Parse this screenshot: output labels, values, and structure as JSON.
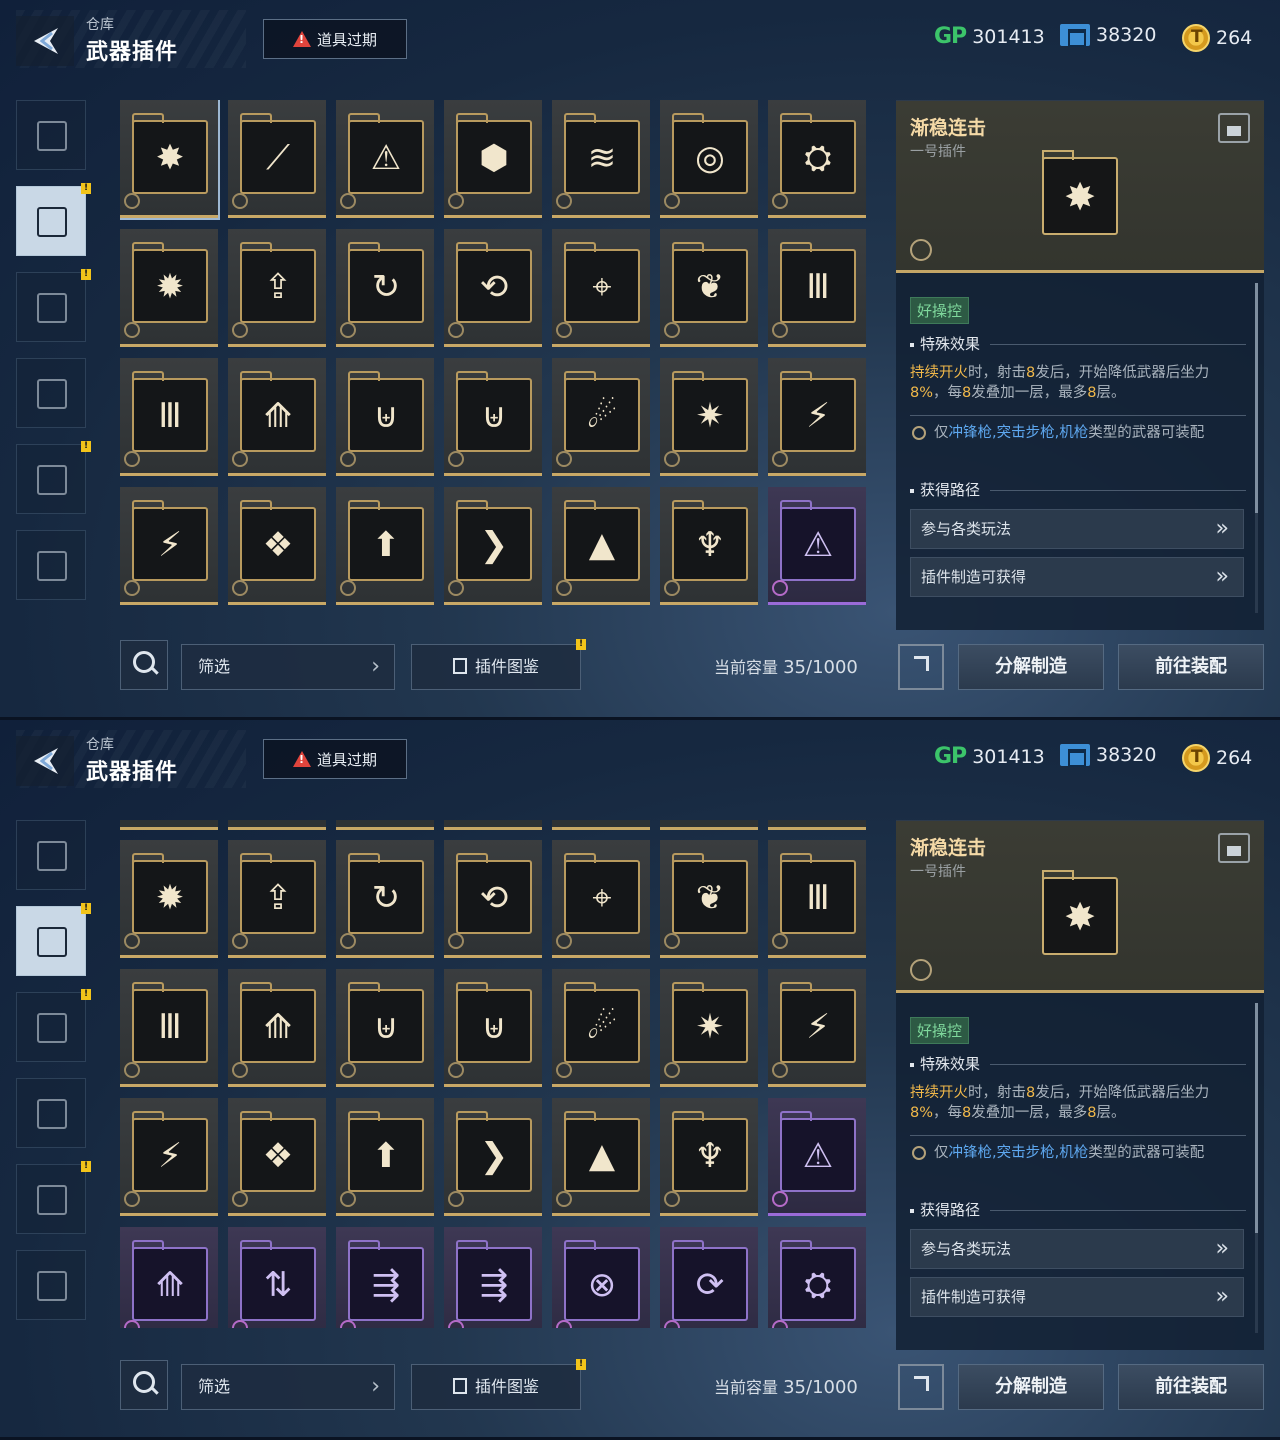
{
  "header": {
    "breadcrumb": "仓库",
    "title": "武器插件",
    "alert_label": "道具过期",
    "currencies": [
      {
        "name": "GP",
        "icon": "gp-icon",
        "value": "301413"
      },
      {
        "name": "ticket",
        "icon": "ticket-icon",
        "value": "38320"
      },
      {
        "name": "coin",
        "icon": "coin-icon",
        "value": "264"
      }
    ]
  },
  "rail": {
    "items": [
      {
        "name": "rail-item-gun",
        "icon": "pistol-icon",
        "active": false,
        "badge": false
      },
      {
        "name": "rail-item-plugin",
        "icon": "plugin-icon",
        "active": true,
        "badge": true
      },
      {
        "name": "rail-item-grenade",
        "icon": "grenade-icon",
        "active": false,
        "badge": true
      },
      {
        "name": "rail-item-skin",
        "icon": "weapon-skin-icon",
        "active": false,
        "badge": false
      },
      {
        "name": "rail-item-character",
        "icon": "character-icon",
        "active": false,
        "badge": true
      },
      {
        "name": "rail-item-badge",
        "icon": "star-badge-icon",
        "active": false,
        "badge": false
      }
    ]
  },
  "grid": {
    "screen1_rows": [
      [
        {
          "g": "✸",
          "p": false,
          "sel": true
        },
        {
          "g": "⟋",
          "p": false
        },
        {
          "g": "⚠",
          "p": false
        },
        {
          "g": "⬢",
          "p": false
        },
        {
          "g": "≋",
          "p": false
        },
        {
          "g": "◎",
          "p": false
        },
        {
          "g": "⛭",
          "p": false
        }
      ],
      [
        {
          "g": "✹",
          "p": false
        },
        {
          "g": "⇪",
          "p": false
        },
        {
          "g": "↻",
          "p": false
        },
        {
          "g": "⟲",
          "p": false
        },
        {
          "g": "⌖",
          "p": false
        },
        {
          "g": "❦",
          "p": false
        },
        {
          "g": "Ⅲ",
          "p": false
        }
      ],
      [
        {
          "g": "Ⅲ",
          "p": false
        },
        {
          "g": "⟰",
          "p": false
        },
        {
          "g": "⊎",
          "p": false
        },
        {
          "g": "⊎",
          "p": false
        },
        {
          "g": "☄",
          "p": false
        },
        {
          "g": "✷",
          "p": false
        },
        {
          "g": "⚡",
          "p": false
        }
      ],
      [
        {
          "g": "⚡",
          "p": false
        },
        {
          "g": "❖",
          "p": false
        },
        {
          "g": "⬆",
          "p": false
        },
        {
          "g": "❯",
          "p": false
        },
        {
          "g": "▲",
          "p": false
        },
        {
          "g": "♆",
          "p": false
        },
        {
          "g": "⚠",
          "p": true
        }
      ]
    ],
    "screen2_rows": [
      [
        {
          "g": "✹",
          "p": false
        },
        {
          "g": "⇪",
          "p": false
        },
        {
          "g": "↻",
          "p": false
        },
        {
          "g": "⟲",
          "p": false
        },
        {
          "g": "⌖",
          "p": false
        },
        {
          "g": "❦",
          "p": false
        },
        {
          "g": "Ⅲ",
          "p": false
        }
      ],
      [
        {
          "g": "Ⅲ",
          "p": false
        },
        {
          "g": "⟰",
          "p": false
        },
        {
          "g": "⊎",
          "p": false
        },
        {
          "g": "⊎",
          "p": false
        },
        {
          "g": "☄",
          "p": false
        },
        {
          "g": "✷",
          "p": false
        },
        {
          "g": "⚡",
          "p": false
        }
      ],
      [
        {
          "g": "⚡",
          "p": false
        },
        {
          "g": "❖",
          "p": false
        },
        {
          "g": "⬆",
          "p": false
        },
        {
          "g": "❯",
          "p": false
        },
        {
          "g": "▲",
          "p": false
        },
        {
          "g": "♆",
          "p": false
        },
        {
          "g": "⚠",
          "p": true
        }
      ],
      [
        {
          "g": "⟰",
          "p": true
        },
        {
          "g": "⇅",
          "p": true
        },
        {
          "g": "⇶",
          "p": true
        },
        {
          "g": "⇶",
          "p": true
        },
        {
          "g": "⊗",
          "p": true
        },
        {
          "g": "⟳",
          "p": true
        },
        {
          "g": "⛭",
          "p": true
        }
      ]
    ]
  },
  "detail": {
    "name": "渐稳连击",
    "subtitle": "一号插件",
    "icon_glyph": "✸",
    "tag": "好操控",
    "effect_heading": "特殊效果",
    "effect_parts": [
      {
        "t": "持续开火",
        "hl": true
      },
      {
        "t": "时，射击",
        "hl": false
      },
      {
        "t": "8",
        "hl": true
      },
      {
        "t": "发后，开始降低武器后坐力",
        "hl": false
      },
      {
        "t": "8%",
        "hl": true
      },
      {
        "t": "，每",
        "hl": false
      },
      {
        "t": "8",
        "hl": true
      },
      {
        "t": "发叠加一层，最多",
        "hl": false
      },
      {
        "t": "8",
        "hl": true
      },
      {
        "t": "层。",
        "hl": false
      }
    ],
    "restriction_parts": [
      {
        "t": "仅",
        "blue": false
      },
      {
        "t": "冲锋枪,突击步枪,机枪",
        "blue": true
      },
      {
        "t": "类型的武器可装配",
        "blue": false
      }
    ],
    "route_heading": "获得路径",
    "routes": [
      "参与各类玩法",
      "插件制造可获得"
    ],
    "route_chevron": "»"
  },
  "bottom": {
    "filter_label": "筛选",
    "atlas_label": "插件图鉴",
    "capacity_label": "当前容量",
    "capacity_value": "35/1000",
    "decompose_label": "分解制造",
    "equip_label": "前往装配"
  }
}
